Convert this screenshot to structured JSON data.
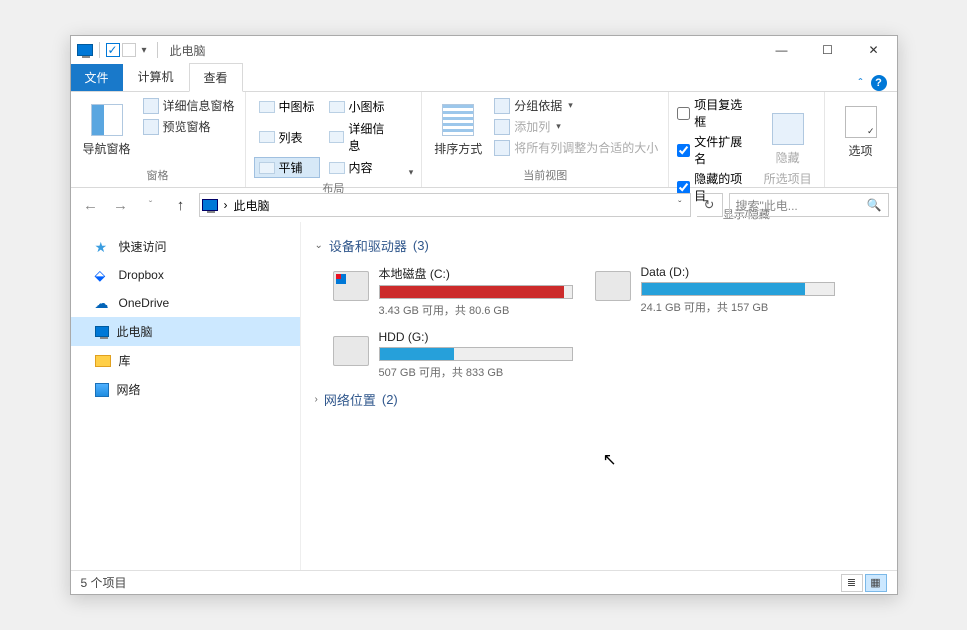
{
  "title": "此电脑",
  "tabs": {
    "file": "文件",
    "computer": "计算机",
    "view": "查看"
  },
  "ribbon": {
    "panes": {
      "nav_pane": "导航窗格",
      "preview_pane": "预览窗格",
      "details_pane": "详细信息窗格",
      "label": "窗格"
    },
    "layout": {
      "medium_icons": "中图标",
      "small_icons": "小图标",
      "list": "列表",
      "details": "详细信息",
      "tiles": "平铺",
      "content": "内容",
      "label": "布局"
    },
    "current_view": {
      "sort_by": "排序方式",
      "group_by": "分组依据",
      "add_columns": "添加列",
      "autosize": "将所有列调整为合适的大小",
      "label": "当前视图"
    },
    "show_hide": {
      "checkboxes": "项目复选框",
      "extensions": "文件扩展名",
      "hidden_items": "隐藏的项目",
      "hide": "隐藏",
      "hide_sub": "所选项目",
      "label": "显示/隐藏"
    },
    "options": {
      "options": "选项"
    }
  },
  "address": {
    "path": "此电脑",
    "separator": "›"
  },
  "search": {
    "placeholder": "搜索\"此电..."
  },
  "sidebar": {
    "items": [
      {
        "label": "快速访问"
      },
      {
        "label": "Dropbox"
      },
      {
        "label": "OneDrive"
      },
      {
        "label": "此电脑"
      },
      {
        "label": "库"
      },
      {
        "label": "网络"
      }
    ]
  },
  "sections": {
    "devices": {
      "label": "设备和驱动器",
      "count": "(3)"
    },
    "network": {
      "label": "网络位置",
      "count": "(2)"
    }
  },
  "drives": [
    {
      "name": "本地磁盘 (C:)",
      "stat": "3.43 GB 可用，共 80.6 GB",
      "fill_pct": 96,
      "fill_class": "fill-red",
      "os": true
    },
    {
      "name": "Data (D:)",
      "stat": "24.1 GB 可用，共 157 GB",
      "fill_pct": 85,
      "fill_class": "fill-blue",
      "os": false
    },
    {
      "name": "HDD (G:)",
      "stat": "507 GB 可用，共 833 GB",
      "fill_pct": 39,
      "fill_class": "fill-blue",
      "os": false
    }
  ],
  "status": {
    "items": "5 个项目"
  }
}
